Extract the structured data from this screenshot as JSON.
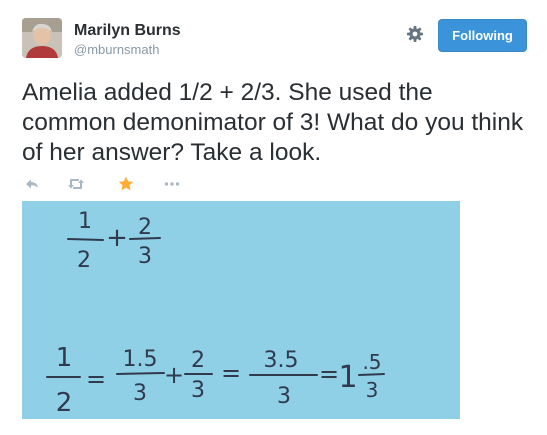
{
  "user": {
    "name": "Marilyn Burns",
    "handle": "@mburnsmath"
  },
  "follow_button": {
    "label": "Following"
  },
  "tweet": {
    "text": "Amelia added 1/2 + 2/3. She used the common demonimator of 3! What do you think of her answer? Take a look."
  },
  "actions": {
    "icons": [
      "reply-icon",
      "retweet-icon",
      "favorite-icon",
      "more-icon"
    ]
  },
  "media": {
    "top_expression": {
      "frac1_num": "1",
      "frac1_den": "2",
      "plus": "+",
      "frac2_num": "2",
      "frac2_den": "3"
    },
    "bottom_expression": {
      "f1_num": "1",
      "f1_den": "2",
      "eq1": "=",
      "f2_num": "1.5",
      "f2_den": "3",
      "plus": "+",
      "f3_num": "2",
      "f3_den": "3",
      "eq2": "=",
      "f4_num": "3.5",
      "f4_den": "3",
      "eq3": "=",
      "whole": "1",
      "f5_num": ".5",
      "f5_den": "3"
    }
  },
  "colors": {
    "follow_button_bg": "#3b94d9",
    "favorite_star": "#ffac33",
    "media_background": "#8fd0e6",
    "handle_text": "#8899a6"
  }
}
